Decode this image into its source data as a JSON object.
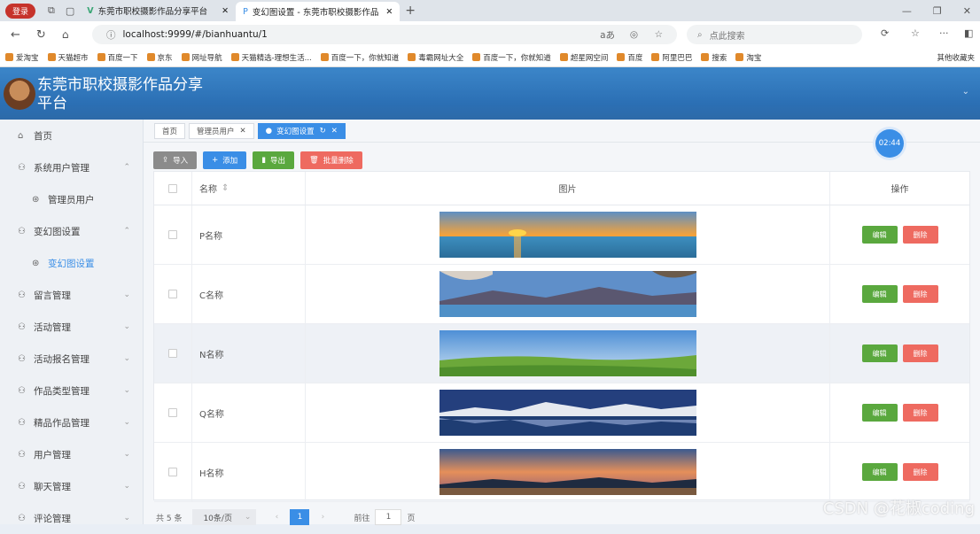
{
  "browser": {
    "login_label": "登录",
    "tab1_title": "东莞市职校摄影作品分享平台",
    "tab2_title": "变幻图设置 - 东莞市职校摄影作品",
    "url": "localhost:9999/#/bianhuantu/1",
    "search_placeholder": "点此搜索",
    "bookmarks": [
      "爱淘宝",
      "天猫超市",
      "百度一下",
      "京东",
      "网址导航",
      "天猫精选-理想生活...",
      "百度一下，你就知道",
      "毒霸网址大全",
      "百度一下，你就知道",
      "超星网空间",
      "百度",
      "阿里巴巴",
      "搜索",
      "淘宝"
    ],
    "other_bookmarks": "其他收藏夹"
  },
  "header": {
    "title": "东莞市职校摄影作品分享平台"
  },
  "sidebar": {
    "items": [
      {
        "label": "首页",
        "arrow": ""
      },
      {
        "label": "系统用户管理",
        "arrow": "^"
      },
      {
        "label": "管理员用户",
        "arrow": "",
        "sub": true
      },
      {
        "label": "变幻图设置",
        "arrow": "^"
      },
      {
        "label": "变幻图设置",
        "arrow": "",
        "sub": true,
        "active": true
      },
      {
        "label": "留言管理",
        "arrow": "v"
      },
      {
        "label": "活动管理",
        "arrow": "v"
      },
      {
        "label": "活动报名管理",
        "arrow": "v"
      },
      {
        "label": "作品类型管理",
        "arrow": "v"
      },
      {
        "label": "精品作品管理",
        "arrow": "v"
      },
      {
        "label": "用户管理",
        "arrow": "v"
      },
      {
        "label": "聊天管理",
        "arrow": "v"
      },
      {
        "label": "评论管理",
        "arrow": "v"
      }
    ]
  },
  "tags": {
    "home": "首页",
    "admin": "管理员用户",
    "current": "变幻图设置"
  },
  "timer": "02:44",
  "toolbar": {
    "import": "导入",
    "add": "添加",
    "export": "导出",
    "batch_delete": "批量删除"
  },
  "table": {
    "headers": {
      "name": "名称",
      "image": "图片",
      "ops": "操作"
    },
    "rows": [
      {
        "name": "P名称",
        "edit": "编辑",
        "delete": "删除"
      },
      {
        "name": "C名称",
        "edit": "编辑",
        "delete": "删除"
      },
      {
        "name": "N名称",
        "edit": "编辑",
        "delete": "删除"
      },
      {
        "name": "Q名称",
        "edit": "编辑",
        "delete": "删除"
      },
      {
        "name": "H名称",
        "edit": "编辑",
        "delete": "删除"
      }
    ]
  },
  "pager": {
    "total": "共 5 条",
    "size": "10条/页",
    "current": "1",
    "goto": "前往",
    "goto_val": "1",
    "unit": "页"
  },
  "watermark": "CSDN @花椒coding"
}
